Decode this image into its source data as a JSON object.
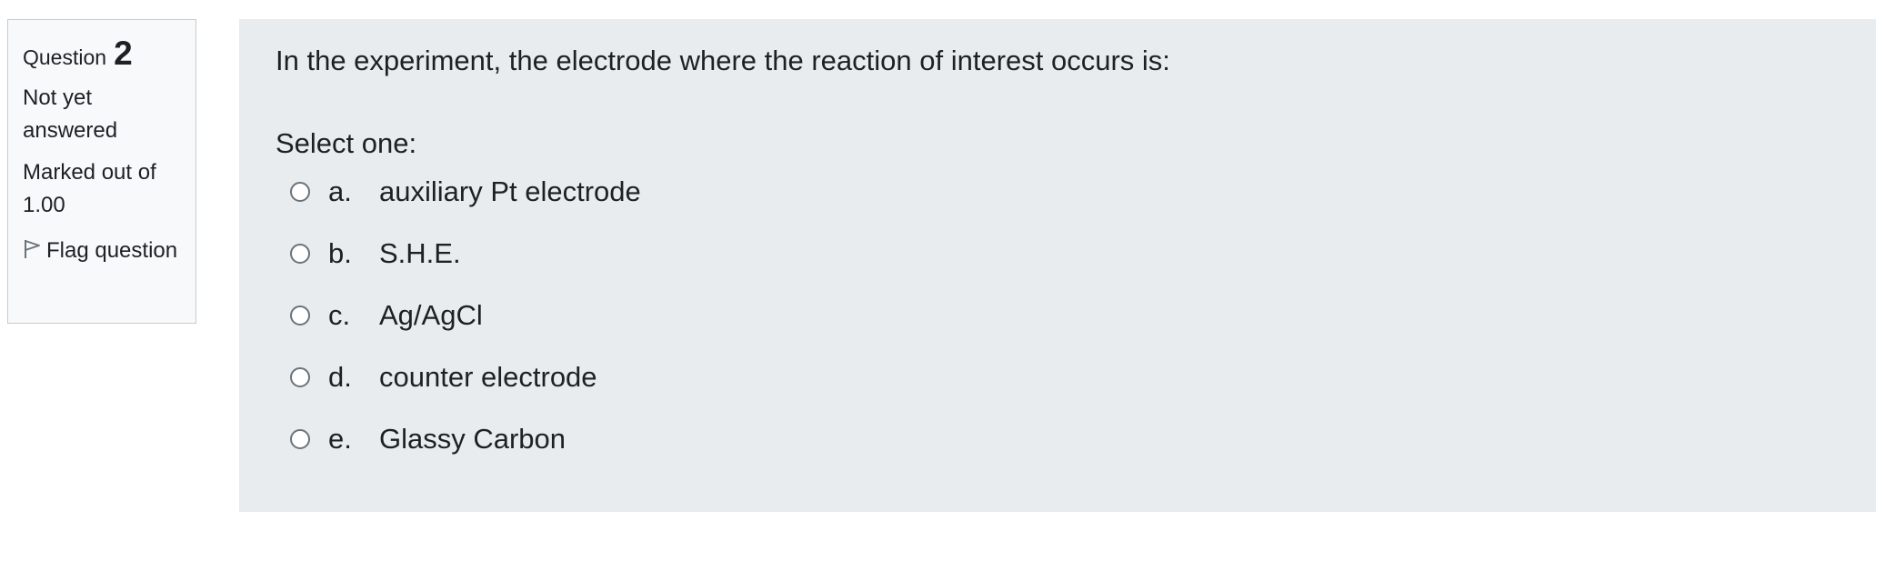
{
  "info": {
    "question_label": "Question",
    "question_number": "2",
    "state": "Not yet answered",
    "marks": "Marked out of 1.00",
    "flag_label": "Flag question",
    "flag_icon": "flag-icon"
  },
  "question": {
    "text": "In the experiment, the electrode where the reaction of interest occurs is:",
    "prompt": "Select one:",
    "answers": [
      {
        "letter": "a.",
        "text": "auxiliary Pt electrode",
        "selected": false
      },
      {
        "letter": "b.",
        "text": "S.H.E.",
        "selected": false
      },
      {
        "letter": "c.",
        "text": "Ag/AgCl",
        "selected": false
      },
      {
        "letter": "d.",
        "text": "counter electrode",
        "selected": false
      },
      {
        "letter": "e.",
        "text": "Glassy Carbon",
        "selected": false
      }
    ]
  },
  "colors": {
    "info_bg": "#f8f9fa",
    "content_bg": "#e9ecee",
    "text": "#1d2125"
  }
}
